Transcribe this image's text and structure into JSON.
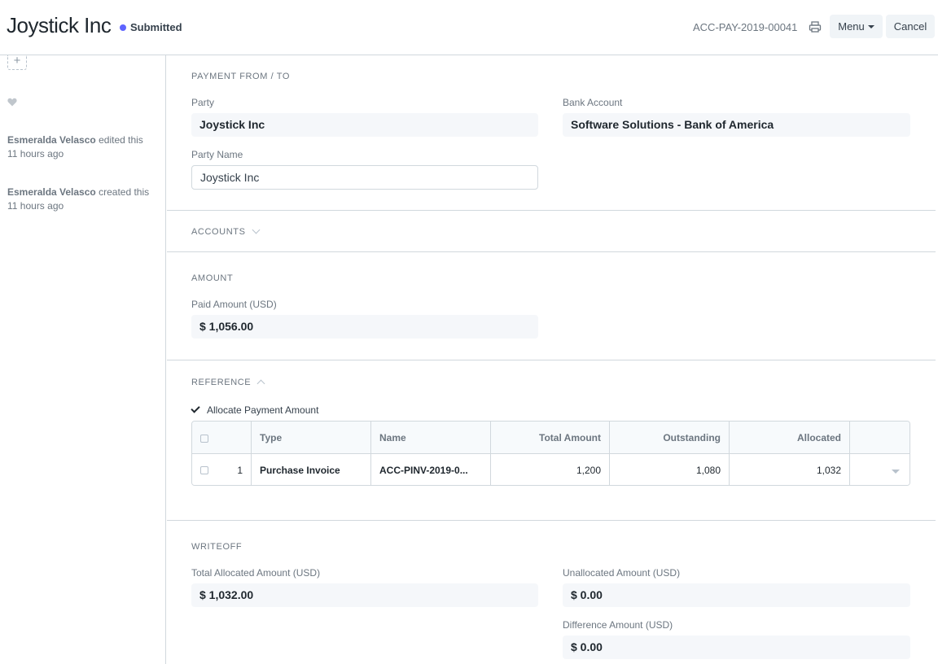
{
  "header": {
    "title": "Joystick Inc",
    "status": "Submitted",
    "status_color": "#5e64ff",
    "doc_name": "ACC-PAY-2019-00041",
    "menu_label": "Menu",
    "cancel_label": "Cancel"
  },
  "sidebar": {
    "add_symbol": "+",
    "activity": [
      {
        "user": "Esmeralda Velasco",
        "action": "edited this",
        "time": "11 hours ago"
      },
      {
        "user": "Esmeralda Velasco",
        "action": "created this",
        "time": "11 hours ago"
      }
    ]
  },
  "sections": {
    "payment_from_to": {
      "heading": "PAYMENT FROM / TO",
      "party_label": "Party",
      "party_value": "Joystick Inc",
      "bank_account_label": "Bank Account",
      "bank_account_value": "Software Solutions - Bank of America",
      "party_name_label": "Party Name",
      "party_name_value": "Joystick Inc"
    },
    "accounts": {
      "heading": "ACCOUNTS"
    },
    "amount": {
      "heading": "AMOUNT",
      "paid_amount_label": "Paid Amount (USD)",
      "paid_amount_value": "$ 1,056.00"
    },
    "reference": {
      "heading": "REFERENCE",
      "allocate_label": "Allocate Payment Amount",
      "columns": [
        "Type",
        "Name",
        "Total Amount",
        "Outstanding",
        "Allocated"
      ],
      "rows": [
        {
          "idx": "1",
          "type": "Purchase Invoice",
          "name": "ACC-PINV-2019-0...",
          "total": "1,200",
          "outstanding": "1,080",
          "allocated": "1,032"
        }
      ]
    },
    "writeoff": {
      "heading": "WRITEOFF",
      "total_allocated_label": "Total Allocated Amount (USD)",
      "total_allocated_value": "$ 1,032.00",
      "unallocated_label": "Unallocated Amount (USD)",
      "unallocated_value": "$ 0.00",
      "difference_label": "Difference Amount (USD)",
      "difference_value": "$ 0.00"
    }
  }
}
